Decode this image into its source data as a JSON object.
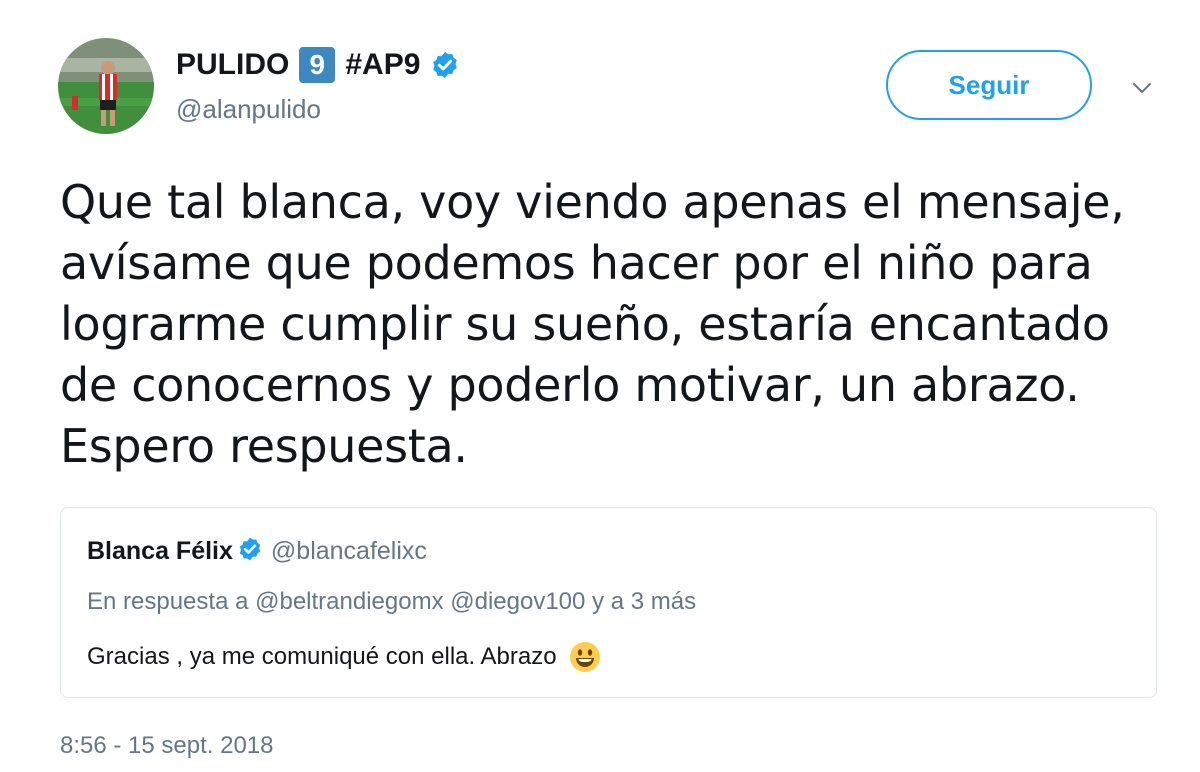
{
  "author": {
    "name": "PULIDO",
    "number_badge": "9",
    "hashtag": "#AP9",
    "handle": "@alanpulido",
    "verified_icon": "verified-badge-icon",
    "avatar_icon": "player-avatar"
  },
  "follow_button": {
    "label": "Seguir"
  },
  "menu_icon": "chevron-down-icon",
  "tweet": {
    "lines": [
      "Que tal blanca, voy viendo apenas el mensaje,",
      "avísame que podemos hacer por el niño para",
      "lograrme cumplir su sueño, estaría encantado",
      "de conocernos y poderlo motivar, un abrazo.",
      "Espero respuesta."
    ]
  },
  "quoted_tweet": {
    "name": "Blanca Félix",
    "handle": "@blancafelixc",
    "reply_prefix": "En respuesta a",
    "reply_to": "@beltrandiegomx @diegov100",
    "reply_suffix": "y a 3 más",
    "text": "Gracias , ya me comuniqué con ella. Abrazo",
    "emoji_icon": "smiley-emoji-icon"
  },
  "timestamp": "8:56 - 15 sept. 2018",
  "colors": {
    "accent": "#1da1f2",
    "secondary_text": "#657786",
    "primary_text": "#14171a",
    "border": "#e1e8ed",
    "badge": "#3b88c3"
  }
}
